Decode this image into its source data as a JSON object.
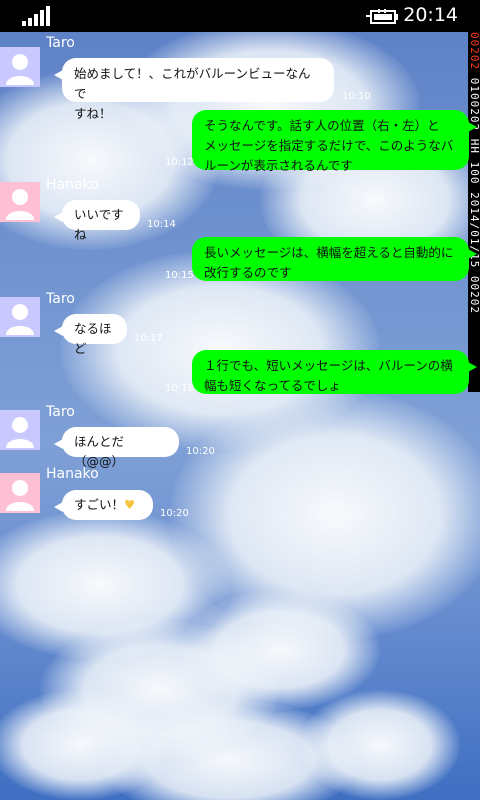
{
  "status": {
    "time": "20:14",
    "battery_icon": "battery-charging-icon",
    "signal_icon": "signal-bars-icon"
  },
  "side_strip": {
    "top_text": "00202",
    "text": "0100202 HH 100 2014/01/15 00202"
  },
  "messages": [
    {
      "sender": "Taro",
      "side": "left",
      "avatar": "blue",
      "text_lines": [
        "始めまして！、これがバルーンビューなんで",
        "すね！"
      ],
      "time": "10:10"
    },
    {
      "sender": "",
      "side": "right",
      "text_lines": [
        "そうなんです。話す人の位置（右・左）と",
        "メッセージを指定するだけで、このようなバ",
        "ルーンが表示されるんです"
      ],
      "time": "10:12"
    },
    {
      "sender": "Hanako",
      "side": "left",
      "avatar": "pink",
      "text_lines": [
        "いいですね"
      ],
      "time": "10:14"
    },
    {
      "sender": "",
      "side": "right",
      "text_lines": [
        "長いメッセージは、横幅を超えると自動的に",
        "改行するのです"
      ],
      "time": "10:15"
    },
    {
      "sender": "Taro",
      "side": "left",
      "avatar": "blue",
      "text_lines": [
        "なるほど"
      ],
      "time": "10:17"
    },
    {
      "sender": "",
      "side": "right",
      "text_lines": [
        "１行でも、短いメッセージは、バルーンの横",
        "幅も短くなってるでしょ"
      ],
      "time": "10:18"
    },
    {
      "sender": "Taro",
      "side": "left",
      "avatar": "blue",
      "text_lines": [
        "ほんとだ（@@）"
      ],
      "time": "10:20"
    },
    {
      "sender": "Hanako",
      "side": "left",
      "avatar": "pink",
      "text_lines": [
        "すごい！"
      ],
      "time": "10:20",
      "emoji": "♥"
    }
  ],
  "colors": {
    "right_bubble": "#00ff00",
    "left_bubble": "#ffffff",
    "avatar_taro": "#c9c9ff",
    "avatar_hanako": "#ffc0d6"
  }
}
